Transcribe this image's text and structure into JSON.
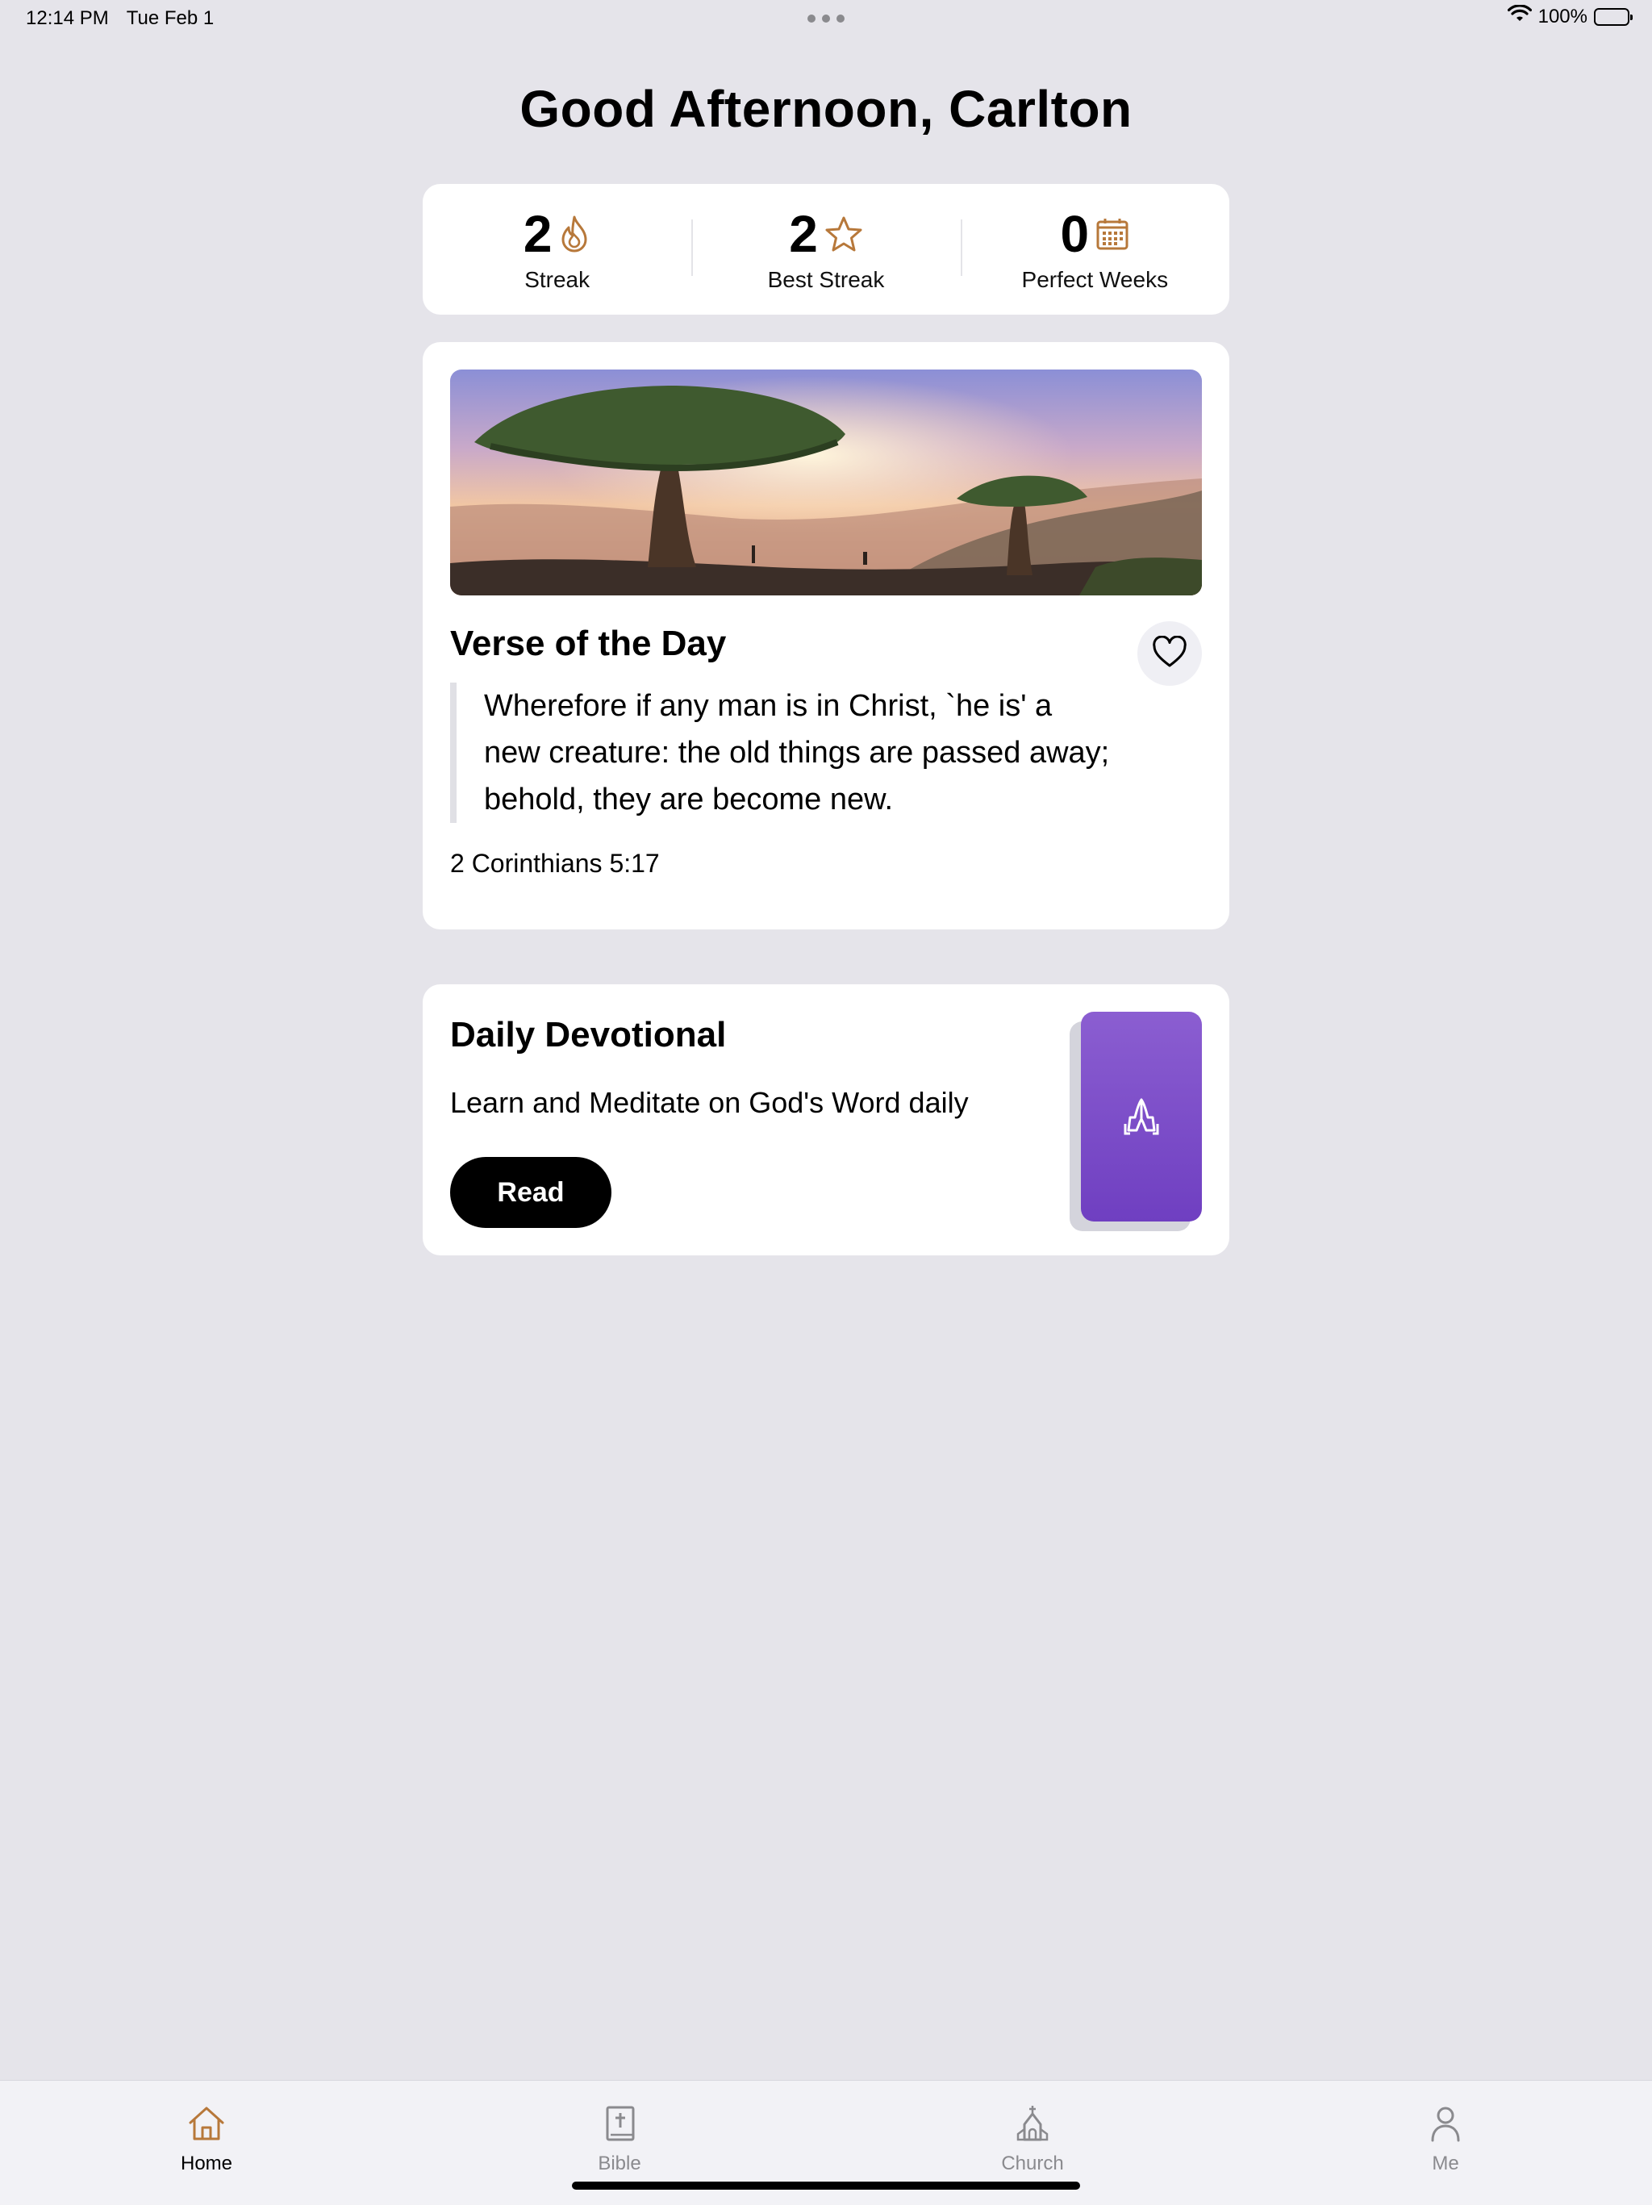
{
  "status_bar": {
    "time": "12:14 PM",
    "date": "Tue Feb 1",
    "battery": "100%"
  },
  "greeting": "Good Afternoon, Carlton",
  "stats": [
    {
      "value": "2",
      "label": "Streak",
      "icon": "flame-icon"
    },
    {
      "value": "2",
      "label": "Best Streak",
      "icon": "star-icon"
    },
    {
      "value": "0",
      "label": "Perfect Weeks",
      "icon": "calendar-icon"
    }
  ],
  "verse_card": {
    "title": "Verse of the Day",
    "text": "Wherefore if any man is in Christ, `he is' a new creature: the old things are passed away; behold, they are become new.",
    "reference": "2 Corinthians 5:17"
  },
  "devotional_card": {
    "title": "Daily Devotional",
    "subtitle": "Learn and Meditate on God's Word daily",
    "button_label": "Read"
  },
  "tabs": [
    {
      "label": "Home",
      "icon": "home-icon",
      "active": true
    },
    {
      "label": "Bible",
      "icon": "bible-icon",
      "active": false
    },
    {
      "label": "Church",
      "icon": "church-icon",
      "active": false
    },
    {
      "label": "Me",
      "icon": "person-icon",
      "active": false
    }
  ],
  "colors": {
    "background": "#e5e4ea",
    "accent_gold": "#b7783a",
    "devotional_purple": "#7a4bc8",
    "button_black": "#000000"
  }
}
